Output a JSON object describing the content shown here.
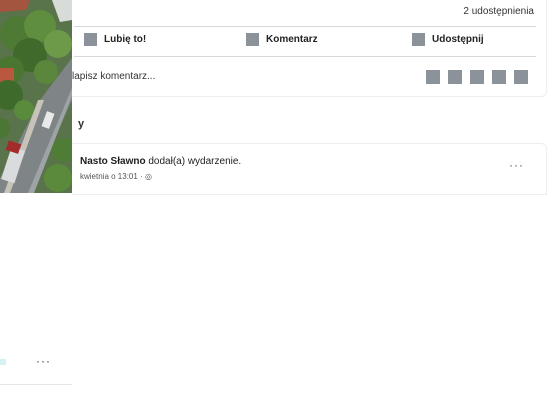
{
  "post_stats": {
    "shares": "2 udostępnienia"
  },
  "actions": {
    "like": "Lubię to!",
    "comment": "Komentarz",
    "share": "Udostępnij"
  },
  "comment_box": {
    "placeholder": "Napisz komentarz…",
    "visible_text": "lapisz komentarz..."
  },
  "comment_tool_icons": [
    "avatar-icon",
    "emoji-icon",
    "camera-icon",
    "gif-icon",
    "sticker-icon"
  ],
  "section": {
    "heading": "y"
  },
  "feed_post": {
    "author": "Nasto Sławno",
    "action_text": "dodał(a) wydarzenie.",
    "meta": "kwietnia o 13:01 · ",
    "more": "···"
  },
  "left_column": {
    "more": "···"
  },
  "colors": {
    "icon_grey": "#8c929a",
    "divider": "#d6d8dc",
    "teal": "#d8f0ef"
  }
}
